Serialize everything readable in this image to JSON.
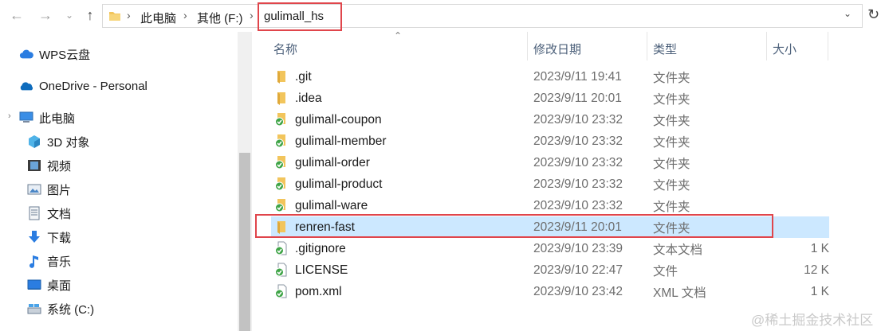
{
  "toolbar": {
    "back_icon": "back-arrow-icon",
    "forward_icon": "forward-arrow-icon",
    "recent_icon": "chevron-down-icon",
    "up_icon": "up-arrow-icon"
  },
  "address": {
    "crumbs": [
      "此电脑",
      "其他 (F:)",
      "gulimall_hs"
    ],
    "separator": "›"
  },
  "nav": {
    "items": [
      {
        "label": "WPS云盘",
        "icon": "cloud-icon"
      },
      {
        "label": "OneDrive - Personal",
        "icon": "onedrive-icon"
      },
      {
        "label": "此电脑",
        "icon": "computer-icon"
      },
      {
        "label": "3D 对象",
        "icon": "3d-objects-icon"
      },
      {
        "label": "视频",
        "icon": "video-icon"
      },
      {
        "label": "图片",
        "icon": "pictures-icon"
      },
      {
        "label": "文档",
        "icon": "documents-icon"
      },
      {
        "label": "下载",
        "icon": "download-icon"
      },
      {
        "label": "音乐",
        "icon": "music-icon"
      },
      {
        "label": "桌面",
        "icon": "desktop-icon"
      },
      {
        "label": "系统 (C:)",
        "icon": "drive-icon"
      }
    ]
  },
  "columns": {
    "name": "名称",
    "date": "修改日期",
    "type": "类型",
    "size": "大小"
  },
  "files": [
    {
      "name": ".git",
      "date": "2023/9/11 19:41",
      "type": "文件夹",
      "size": "",
      "icon": "folder-icon"
    },
    {
      "name": ".idea",
      "date": "2023/9/11 20:01",
      "type": "文件夹",
      "size": "",
      "icon": "folder-icon"
    },
    {
      "name": "gulimall-coupon",
      "date": "2023/9/10 23:32",
      "type": "文件夹",
      "size": "",
      "icon": "git-folder-icon"
    },
    {
      "name": "gulimall-member",
      "date": "2023/9/10 23:32",
      "type": "文件夹",
      "size": "",
      "icon": "git-folder-icon"
    },
    {
      "name": "gulimall-order",
      "date": "2023/9/10 23:32",
      "type": "文件夹",
      "size": "",
      "icon": "git-folder-icon"
    },
    {
      "name": "gulimall-product",
      "date": "2023/9/10 23:32",
      "type": "文件夹",
      "size": "",
      "icon": "git-folder-icon"
    },
    {
      "name": "gulimall-ware",
      "date": "2023/9/10 23:32",
      "type": "文件夹",
      "size": "",
      "icon": "git-folder-icon"
    },
    {
      "name": "renren-fast",
      "date": "2023/9/11 20:01",
      "type": "文件夹",
      "size": "",
      "icon": "folder-icon",
      "selected": true
    },
    {
      "name": ".gitignore",
      "date": "2023/9/10 23:39",
      "type": "文本文档",
      "size": "1 K",
      "icon": "git-file-icon"
    },
    {
      "name": "LICENSE",
      "date": "2023/9/10 22:47",
      "type": "文件",
      "size": "12 K",
      "icon": "git-file-icon"
    },
    {
      "name": "pom.xml",
      "date": "2023/9/10 23:42",
      "type": "XML 文档",
      "size": "1 K",
      "icon": "git-file-icon"
    }
  ],
  "watermark": "@稀土掘金技术社区",
  "colors": {
    "selection": "#cce8ff",
    "highlight_box": "#e0454b",
    "folder": "#f2c55c",
    "git_green": "#3fa447"
  }
}
